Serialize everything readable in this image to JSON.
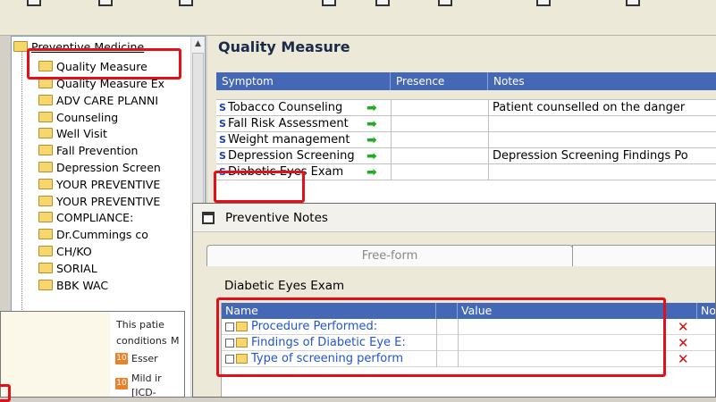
{
  "tree": {
    "items": [
      "Preventive Medicine",
      "Quality Measure",
      "Quality Measure Ex",
      "ADV CARE PLANNI",
      "Counseling",
      "Well Visit",
      "Fall Prevention",
      "Depression Screen",
      "YOUR PREVENTIVE",
      "YOUR PREVENTIVE",
      "COMPLIANCE:",
      "Dr.Cummings co",
      "CH/KO",
      "SORIAL",
      "BBK WAC"
    ]
  },
  "main": {
    "title": "Quality Measure",
    "columns": [
      "Symptom",
      "Presence",
      "Notes"
    ],
    "rows": [
      {
        "symbol": "S",
        "symptom": "Tobacco Counseling",
        "notes": "Patient counselled on the danger"
      },
      {
        "symbol": "S",
        "symptom": "Fall Risk Assessment",
        "notes": ""
      },
      {
        "symbol": "S",
        "symptom": "Weight management",
        "notes": ""
      },
      {
        "symbol": "S",
        "symptom": "Depression Screening",
        "notes": "Depression Screening Findings Po"
      },
      {
        "symbol": "S",
        "symptom": "Diabetic Eyes Exam",
        "notes": ""
      }
    ]
  },
  "dialog": {
    "title": "Preventive Notes",
    "tab_label": "Free-form",
    "subtitle": "Diabetic Eyes Exam",
    "columns": [
      "Name",
      "Value",
      "No"
    ],
    "rows": [
      {
        "name": "Procedure Performed:"
      },
      {
        "name": "Findings of Diabetic Eye E:"
      },
      {
        "name": "Type of screening perform"
      }
    ]
  },
  "popup": {
    "line1": "This patie",
    "line2": "conditions",
    "line2_suffix": "M",
    "item1_badge": "10",
    "item1_text": "Esser",
    "item2_badge": "10",
    "item2_text": "Mild ir",
    "item2_sub": "[ICD-"
  },
  "colors": {
    "header_blue": "#4468b6",
    "highlight_red": "#e3101a",
    "link_blue": "#2255cc",
    "arrow_green": "#1fae1f",
    "delete_red": "#d21010"
  }
}
